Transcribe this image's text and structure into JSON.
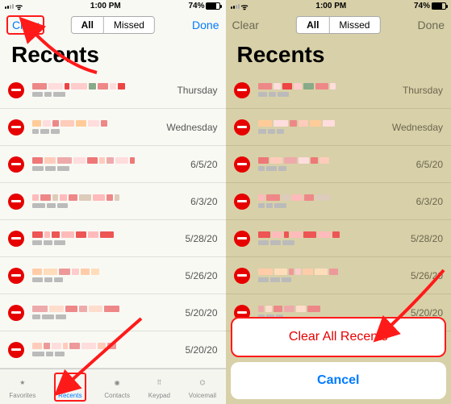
{
  "status": {
    "carrier": "",
    "time": "1:00 PM",
    "battery": "74%"
  },
  "nav": {
    "clear": "Clear",
    "all": "All",
    "missed": "Missed",
    "done": "Done"
  },
  "title": "Recents",
  "calls": [
    {
      "date": "Thursday"
    },
    {
      "date": "Wednesday"
    },
    {
      "date": "6/5/20"
    },
    {
      "date": "6/3/20"
    },
    {
      "date": "5/28/20"
    },
    {
      "date": "5/26/20"
    },
    {
      "date": "5/20/20"
    },
    {
      "date": "5/20/20"
    }
  ],
  "tabs": {
    "favorites": "Favorites",
    "recents": "Recents",
    "contacts": "Contacts",
    "keypad": "Keypad",
    "voicemail": "Voicemail"
  },
  "sheet": {
    "clear_all": "Clear All Recents",
    "cancel": "Cancel"
  }
}
